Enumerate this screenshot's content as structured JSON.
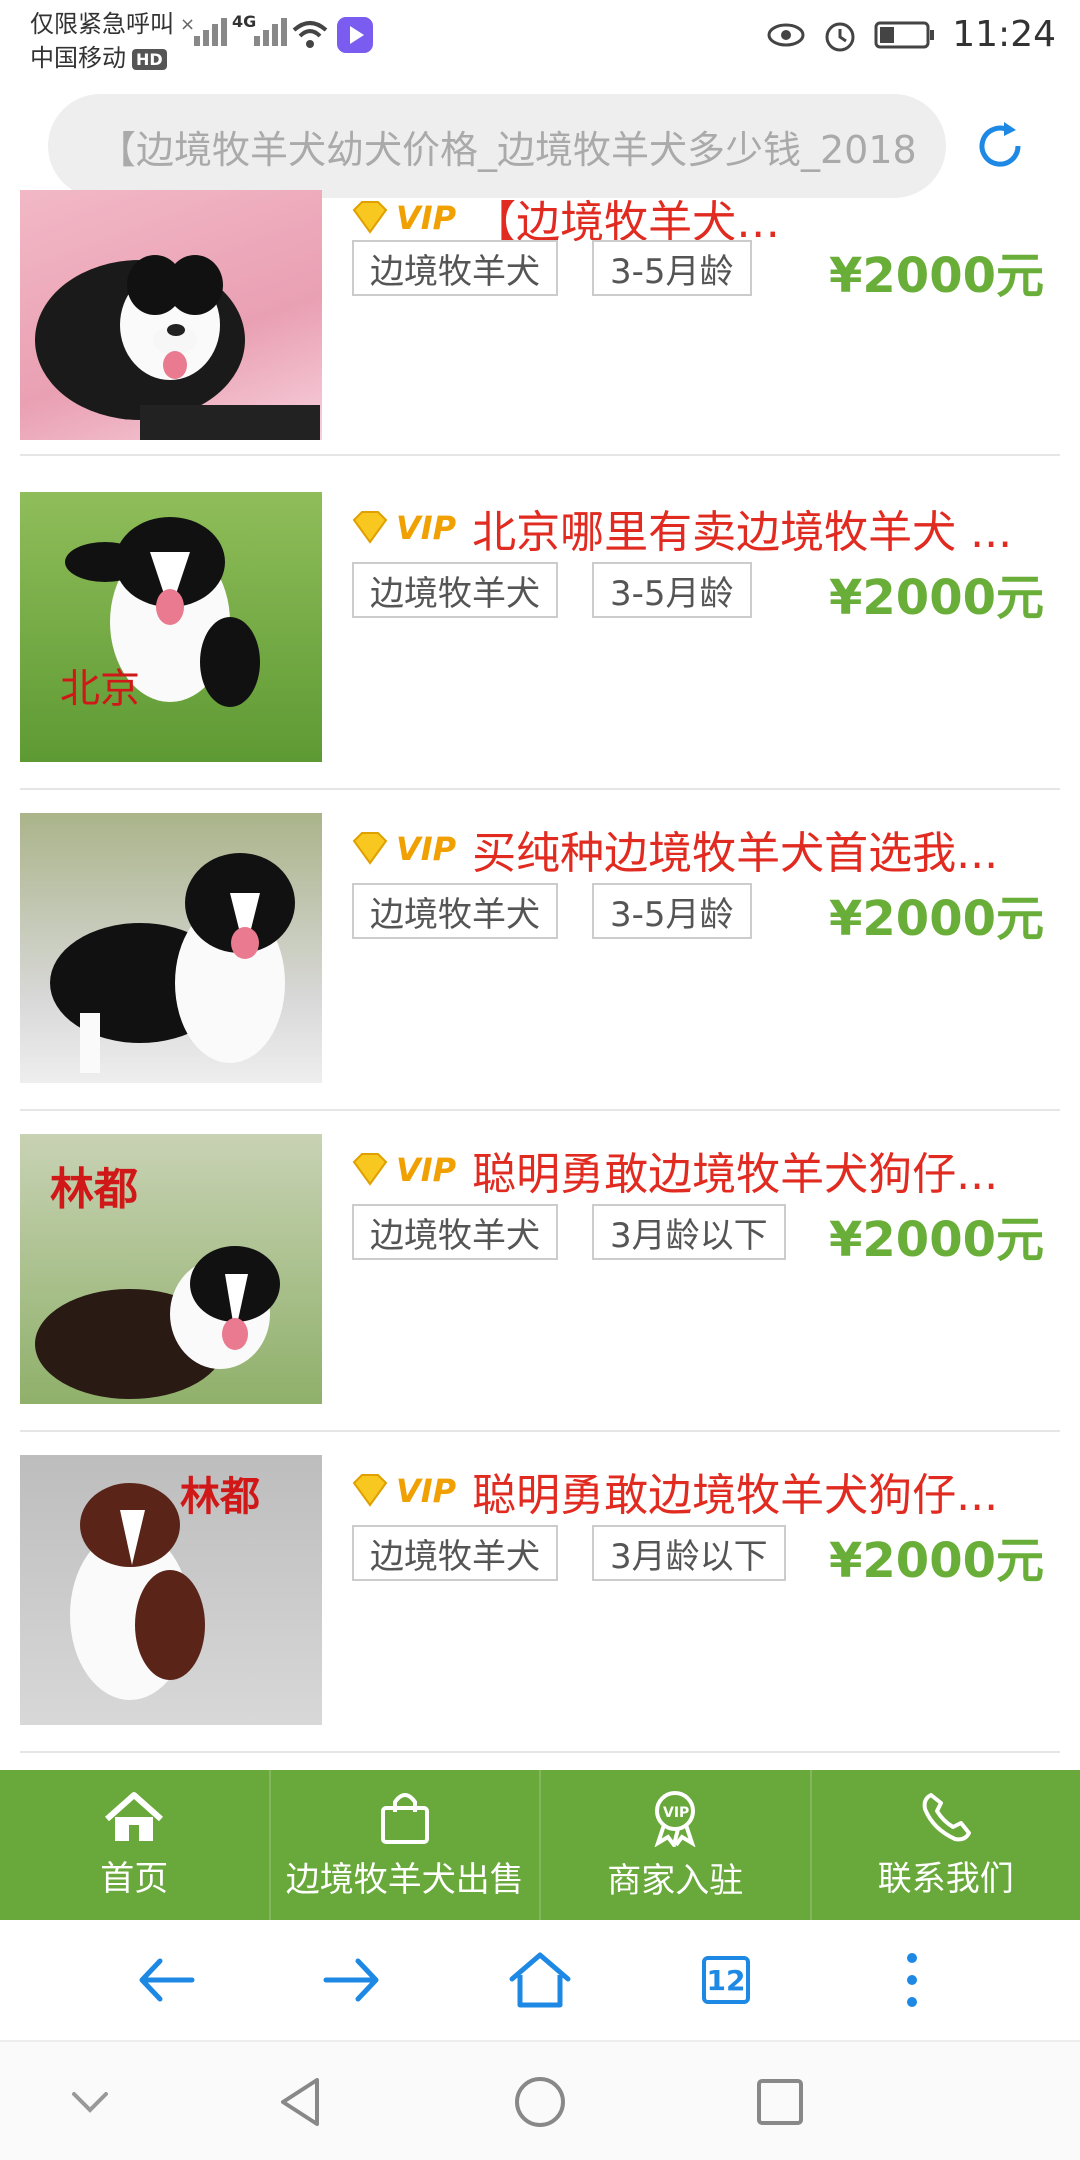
{
  "status": {
    "carrier_line1": "仅限紧急呼叫",
    "carrier_line2": "中国移动",
    "hd_badge": "HD",
    "network": "4G",
    "time": "11:24"
  },
  "search": {
    "text": "【边境牧羊犬幼犬价格_边境牧羊犬多少钱_2018"
  },
  "listings": [
    {
      "title": "【边境牧羊犬…",
      "vip": "VIP",
      "tag1": "边境牧羊犬",
      "tag2": "3-5月龄",
      "price": "¥2000元",
      "image": "puppy-photo-1"
    },
    {
      "title": "北京哪里有卖边境牧羊犬 ...",
      "vip": "VIP",
      "tag1": "边境牧羊犬",
      "tag2": "3-5月龄",
      "price": "¥2000元",
      "image": "puppy-photo-2"
    },
    {
      "title": "买纯种边境牧羊犬首选我...",
      "vip": "VIP",
      "tag1": "边境牧羊犬",
      "tag2": "3-5月龄",
      "price": "¥2000元",
      "image": "puppy-photo-3"
    },
    {
      "title": "聪明勇敢边境牧羊犬狗仔...",
      "vip": "VIP",
      "tag1": "边境牧羊犬",
      "tag2": "3月龄以下",
      "price": "¥2000元",
      "image": "puppy-photo-4"
    },
    {
      "title": "聪明勇敢边境牧羊犬狗仔...",
      "vip": "VIP",
      "tag1": "边境牧羊犬",
      "tag2": "3月龄以下",
      "price": "¥2000元",
      "image": "puppy-photo-5"
    }
  ],
  "nav": {
    "home": "首页",
    "sale": "边境牧羊犬出售",
    "merchant": "商家入驻",
    "contact": "联系我们"
  },
  "browser": {
    "tab_count": "12"
  },
  "colors": {
    "accent_green": "#69a83a",
    "price_green": "#6aae3a",
    "title_red": "#e12a20",
    "browser_blue": "#1e88e5"
  }
}
